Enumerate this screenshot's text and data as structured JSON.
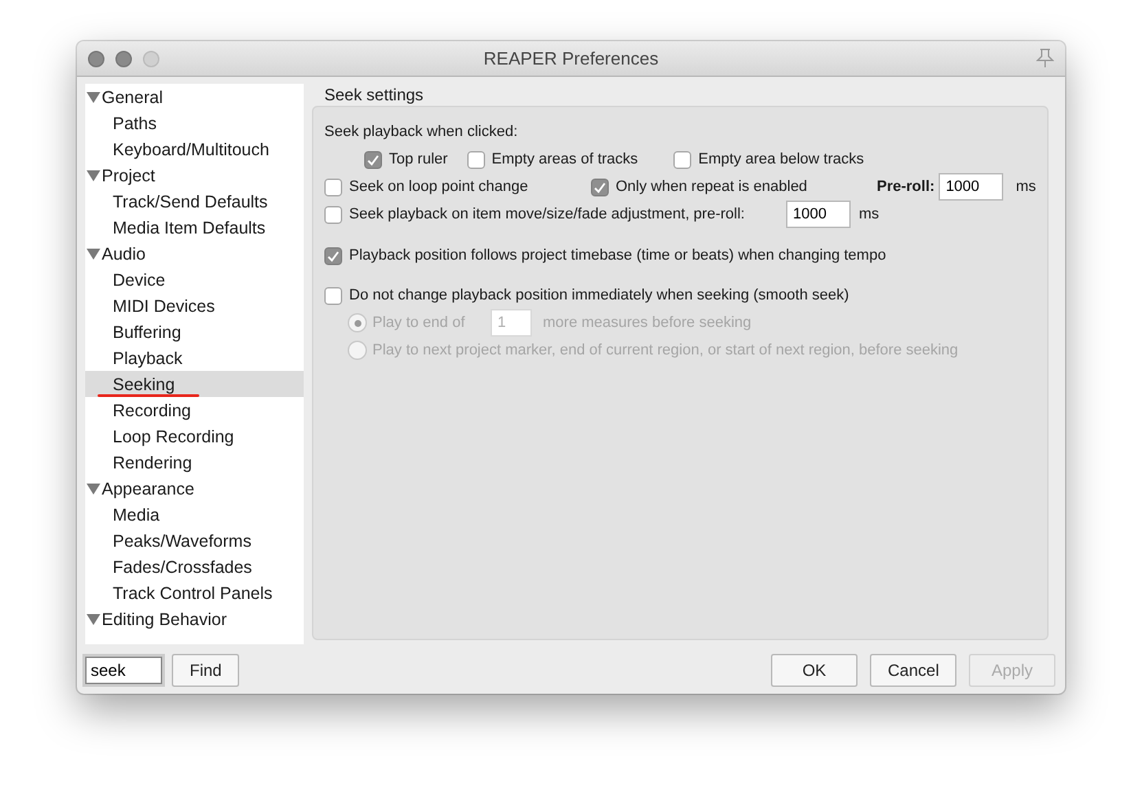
{
  "window": {
    "title": "REAPER Preferences"
  },
  "sidebar": {
    "items": [
      {
        "label": "General",
        "expanded": true,
        "children": [
          {
            "label": "Paths",
            "selected": false,
            "underlined": false
          },
          {
            "label": "Keyboard/Multitouch",
            "selected": false,
            "underlined": false
          }
        ]
      },
      {
        "label": "Project",
        "expanded": true,
        "children": [
          {
            "label": "Track/Send Defaults",
            "selected": false,
            "underlined": false
          },
          {
            "label": "Media Item Defaults",
            "selected": false,
            "underlined": false
          }
        ]
      },
      {
        "label": "Audio",
        "expanded": true,
        "children": [
          {
            "label": "Device",
            "selected": false,
            "underlined": false
          },
          {
            "label": "MIDI Devices",
            "selected": false,
            "underlined": false
          },
          {
            "label": "Buffering",
            "selected": false,
            "underlined": false
          },
          {
            "label": "Playback",
            "selected": false,
            "underlined": false
          },
          {
            "label": "Seeking",
            "selected": true,
            "underlined": true
          },
          {
            "label": "Recording",
            "selected": false,
            "underlined": false
          },
          {
            "label": "Loop Recording",
            "selected": false,
            "underlined": false
          },
          {
            "label": "Rendering",
            "selected": false,
            "underlined": false
          }
        ]
      },
      {
        "label": "Appearance",
        "expanded": true,
        "children": [
          {
            "label": "Media",
            "selected": false,
            "underlined": false
          },
          {
            "label": "Peaks/Waveforms",
            "selected": false,
            "underlined": false
          },
          {
            "label": "Fades/Crossfades",
            "selected": false,
            "underlined": false
          },
          {
            "label": "Track Control Panels",
            "selected": false,
            "underlined": false
          }
        ]
      },
      {
        "label": "Editing Behavior",
        "expanded": true
      }
    ]
  },
  "panel": {
    "title": "Seek settings",
    "seek_on_click": {
      "label": "Seek playback when clicked:",
      "options": [
        {
          "label": "Top ruler",
          "checked": true
        },
        {
          "label": "Empty areas of tracks",
          "checked": false
        },
        {
          "label": "Empty area below tracks",
          "checked": false
        }
      ]
    },
    "loop_seek": {
      "label": "Seek on loop point change",
      "checked": false,
      "repeat_only": {
        "label": "Only when repeat is enabled",
        "checked": true
      },
      "preroll": {
        "label": "Pre-roll:",
        "value": "1000",
        "unit": "ms"
      }
    },
    "item_seek": {
      "label": "Seek playback on item move/size/fade adjustment, pre-roll:",
      "checked": false,
      "value": "1000",
      "unit": "ms"
    },
    "follow_timebase": {
      "label": "Playback position follows project timebase (time or beats) when changing tempo",
      "checked": true
    },
    "smooth_seek": {
      "label": "Do not change playback position immediately when seeking (smooth seek)",
      "checked": false,
      "options": [
        {
          "kind": "measures",
          "label": "Play to end of",
          "value": "1",
          "suffix": "more measures before seeking",
          "selected": true,
          "disabled": true
        },
        {
          "kind": "plain",
          "label": "Play to next project marker, end of current region, or start of next region, before seeking",
          "selected": false,
          "disabled": true
        }
      ]
    }
  },
  "footer": {
    "find_field": {
      "value": "seek"
    },
    "find_button": "Find",
    "buttons": [
      {
        "label": "OK",
        "disabled": false
      },
      {
        "label": "Cancel",
        "disabled": false
      },
      {
        "label": "Apply",
        "disabled": true
      }
    ]
  }
}
